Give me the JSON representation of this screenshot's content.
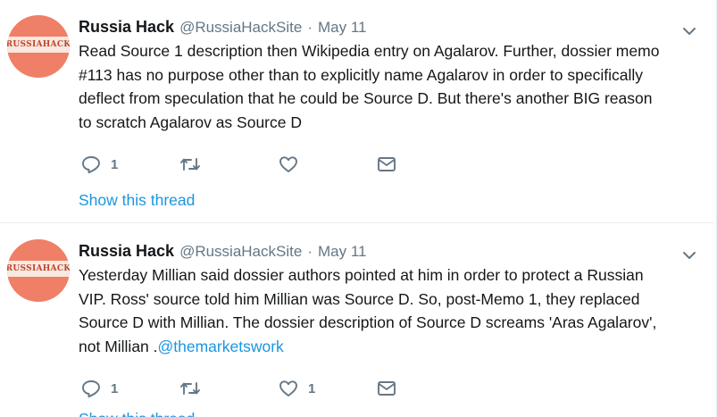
{
  "tweets": [
    {
      "avatar_text": "RUSSIAHACK",
      "name": "Russia Hack",
      "handle": "@RussiaHackSite",
      "separator": "·",
      "date": "May 11",
      "text": "Read Source 1 description then Wikipedia entry on Agalarov. Further, dossier memo #113 has no purpose other than to explicitly name Agalarov in order to specifically deflect from speculation that he could be Source D. But there's another BIG reason to scratch Agalarov as Source D",
      "link": "",
      "reply_count": "1",
      "retweet_count": "",
      "like_count": "",
      "show_thread": "Show this thread"
    },
    {
      "avatar_text": "RUSSIAHACK",
      "name": "Russia Hack",
      "handle": "@RussiaHackSite",
      "separator": "·",
      "date": "May 11",
      "text": "Yesterday Millian said dossier authors pointed at him in order to protect a Russian VIP. Ross' source told him Millian was Source D. So, post-Memo 1, they replaced Source D with Millian. The dossier description of Source D screams 'Aras Agalarov', not Millian .",
      "link": "@themarketswork",
      "reply_count": "1",
      "retweet_count": "",
      "like_count": "1",
      "show_thread": "Show this thread"
    }
  ],
  "icons": {
    "reply": "reply-icon",
    "retweet": "retweet-icon",
    "like": "heart-icon",
    "dm": "envelope-icon",
    "caret": "chevron-down-icon"
  },
  "colors": {
    "link": "#1b95e0",
    "secondary": "#657786",
    "avatar": "#ef7f66"
  }
}
